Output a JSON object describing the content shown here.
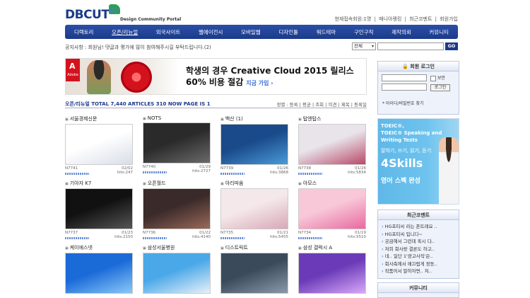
{
  "header": {
    "logo_main": "DBCUT",
    "logo_sub": "Design Community Portal",
    "top_links": [
      "현재접속회원:1명",
      "|",
      "매니아랭킹",
      "|",
      "최근코멘트",
      "|",
      "회원가입"
    ]
  },
  "nav": {
    "items": [
      "디렉토리",
      "오픈/리뉴얼",
      "외국사이트",
      "웹에이전시",
      "모바일웹",
      "디자인툴",
      "워드테마",
      "구인구직",
      "제작의뢰",
      "커뮤니티"
    ],
    "active_index": 1
  },
  "notice": "공지사항 : 회원님! 댓글과 평가에 많이 참여해주시길 부탁드립니다.(2)",
  "search": {
    "select_value": "전체",
    "button": "GO"
  },
  "banner": {
    "brand": "Adobe",
    "line1": "학생의 경우 Creative Cloud 2015 릴리스",
    "line2": "60% 비용 절감",
    "cta": "지금 가입 ›"
  },
  "list": {
    "count": "오픈/리뉴얼 TOTAL  7,440 ARTICLES 310 NOW PAGE IS  1",
    "sort": "정렬 : 등록 | 평균 | 조회 | 의견 | 제목 | 등록일"
  },
  "cards": [
    {
      "title": "서울경제신문",
      "no": "N7741",
      "date": "02/02",
      "hits": "hits:247",
      "colors": [
        "#ffffff",
        "#d8dde8"
      ]
    },
    {
      "title": "NOTS",
      "no": "N7740",
      "date": "01/29",
      "hits": "hits:2727",
      "colors": [
        "#2a2a2a",
        "#6a6a6a"
      ]
    },
    {
      "title": "백산 (1)",
      "no": "N7739",
      "date": "01/26",
      "hits": "hits:3868",
      "colors": [
        "#1a4a8a",
        "#4a9ad8"
      ]
    },
    {
      "title": "탑엔탑스",
      "no": "N7738",
      "date": "01/26",
      "hits": "hits:5834",
      "colors": [
        "#e8e4ea",
        "#b84a6a"
      ]
    },
    {
      "title": "기아자 K7",
      "no": "N7737",
      "date": "01/23",
      "hits": "hits:2150",
      "colors": [
        "#111111",
        "#555555"
      ]
    },
    {
      "title": "오픈월드",
      "no": "N7736",
      "date": "01/22",
      "hits": "hits:4140",
      "colors": [
        "#3a2a2a",
        "#9a6a5a"
      ]
    },
    {
      "title": "아리따움",
      "no": "N7735",
      "date": "01/21",
      "hits": "hits:5455",
      "colors": [
        "#f4e8ea",
        "#d8a8b8"
      ]
    },
    {
      "title": "아모스",
      "no": "N7734",
      "date": "01/19",
      "hits": "hits:5510",
      "colors": [
        "#f8c8d8",
        "#e86aa0"
      ]
    },
    {
      "title": "케이에스넷",
      "no": "",
      "date": "",
      "hits": "",
      "colors": [
        "#1a6ad8",
        "#8ac8f8"
      ]
    },
    {
      "title": "삼성서울병원",
      "no": "",
      "date": "",
      "hits": "",
      "colors": [
        "#4aa8e8",
        "#e8f0f8"
      ]
    },
    {
      "title": "디스트릭트",
      "no": "",
      "date": "",
      "hits": "",
      "colors": [
        "#3a4a5a",
        "#8a9aaa"
      ]
    },
    {
      "title": "삼성 갤럭시 A",
      "no": "",
      "date": "",
      "hits": "",
      "colors": [
        "#6a3ab8",
        "#d8a8f8"
      ]
    }
  ],
  "sidebar": {
    "login_title": "회원 로그인",
    "save_id": "보안",
    "login_button": "로그인",
    "find_link": "* 아이디/비밀번호 찾기",
    "ad": {
      "line1": "TOEIC®,",
      "line2": "TOEIC® Speaking and",
      "line3": "Writing Tests",
      "line4": "말하기, 쓰기, 읽기, 듣기",
      "line5": "4Skills",
      "line6": "영어 스펙 완성"
    },
    "recent_title": "최근코멘트",
    "recent": [
      "HG프티씨 라는 폰트래요 ..",
      "HG프티씨 입니다~",
      "궁금해서 그런데 혹시 다..",
      "저희 회사랑 결론도 하고..",
      "네.. 일단 1'광고사직'은..",
      "회사측에서 매끄럽게 정동..",
      "작품어서 말하자면.. 저.."
    ],
    "community_title": "커뮤니티"
  }
}
